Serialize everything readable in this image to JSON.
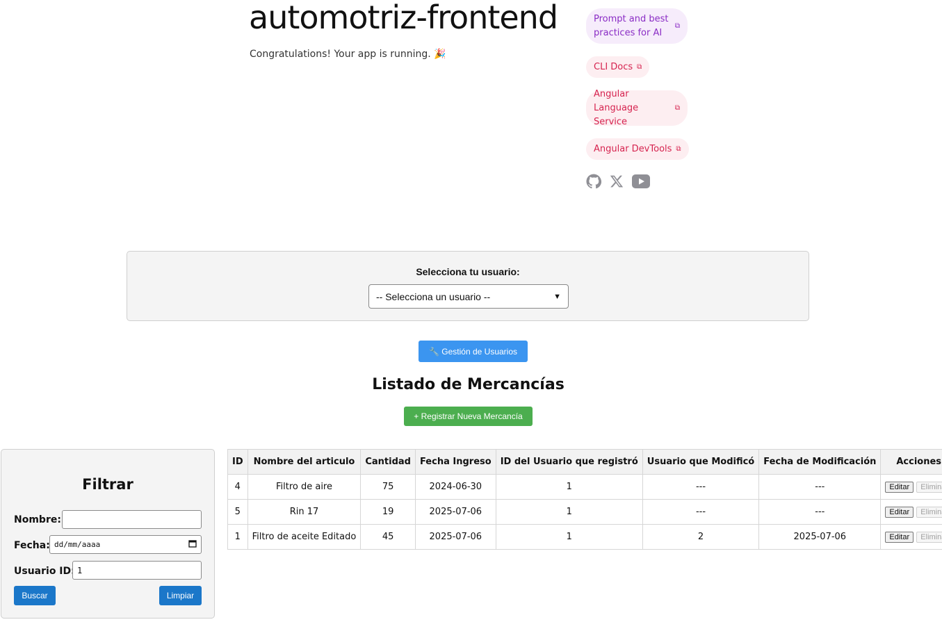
{
  "hero": {
    "title": "automotriz-frontend",
    "subtitle": "Congratulations! Your app is running. 🎉"
  },
  "links": [
    {
      "label": "Prompt and best practices for AI",
      "icon": "external-link-icon",
      "color": "#8a2cc5"
    },
    {
      "label": "CLI Docs",
      "icon": "external-link-icon",
      "color": "#d6234f"
    },
    {
      "label": "Angular Language Service",
      "icon": "external-link-icon",
      "color": "#d6234f"
    },
    {
      "label": "Angular DevTools",
      "icon": "external-link-icon",
      "color": "#d6234f"
    }
  ],
  "socials": [
    "github-icon",
    "x-icon",
    "youtube-icon"
  ],
  "user_selector": {
    "label": "Selecciona tu usuario:",
    "selected": "-- Selecciona un usuario --"
  },
  "actions": {
    "users_button": "🔧 Gestión de Usuarios",
    "list_title": "Listado de Mercancías",
    "register_button": "+ Registrar Nueva Mercancía"
  },
  "filter": {
    "title": "Filtrar",
    "name_label": "Nombre:",
    "name_value": "",
    "date_label": "Fecha:",
    "date_placeholder": "dd/mm/aaaa",
    "user_label": "Usuario ID:",
    "user_value": "1",
    "search_button": "Buscar",
    "clear_button": "Limpiar"
  },
  "table": {
    "headers": [
      "ID",
      "Nombre del articulo",
      "Cantidad",
      "Fecha Ingreso",
      "ID del Usuario que registró",
      "Usuario que Modificó",
      "Fecha de Modificación",
      "Acciones"
    ],
    "rows": [
      [
        "4",
        "Filtro de aire",
        "75",
        "2024-06-30",
        "1",
        "---",
        "---"
      ],
      [
        "5",
        "Rin 17",
        "19",
        "2025-07-06",
        "1",
        "---",
        "---"
      ],
      [
        "1",
        "Filtro de aceite Editado",
        "45",
        "2025-07-06",
        "1",
        "2",
        "2025-07-06"
      ]
    ],
    "edit_label": "Editar",
    "delete_label": "Eliminar"
  },
  "colors": {
    "primary_blue": "#3b95f0",
    "filter_blue": "#1b77c9",
    "success_green": "#4cae4f",
    "link_pink": "#d6234f",
    "link_purple": "#8a2cc5"
  }
}
